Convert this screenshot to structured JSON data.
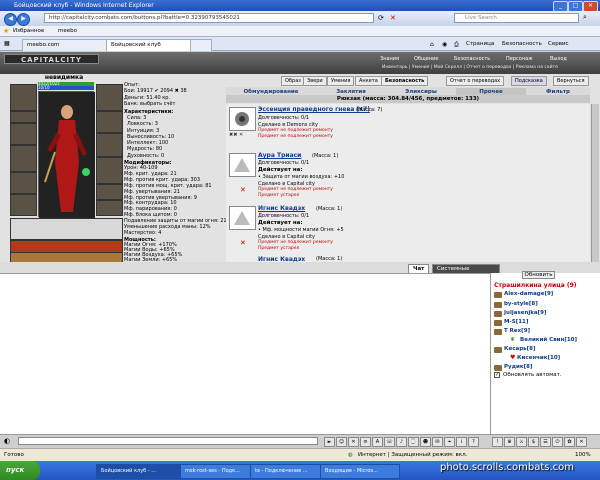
{
  "window": {
    "title": "Бойцовский клуб - Windows Internet Explorer"
  },
  "address": {
    "url": "http://capitalcity.combats.com/buttons.pl?battle=0.32390793545021",
    "search_placeholder": "Live Search"
  },
  "favorites": {
    "label": "Избранное",
    "link": "meebo"
  },
  "tabs": [
    {
      "label": "meebo.com"
    },
    {
      "label": "Бойцовский клуб"
    }
  ],
  "commands": {
    "page": "Страница",
    "security": "Безопасность",
    "service": "Сервис"
  },
  "game": {
    "logo": "CAPITALCITY",
    "nav": [
      "Знания",
      "Общение",
      "Безопасность",
      "Персонаж",
      "Выход"
    ],
    "subnav": "Инвентарь | Умения | Мой Скролл | Отчет о переводах | Реклама на сайте",
    "character": {
      "name": "невидимка",
      "hp": "1022/1022",
      "mana": "10/10",
      "stats_top": [
        "Опыт:",
        "Бои: 19917 ✔ 2094 ✖ 38",
        "Деньги: 51.40 кр.",
        "Банк: выбрать счёт"
      ],
      "characteristics_title": "Характеристики:",
      "characteristics": [
        "Сила: 3",
        "Ловкость: 3",
        "Интуиция: 3",
        "Выносливость: 10",
        "Интеллект: 100",
        "Мудрость: 80",
        "Духовность: 0"
      ],
      "modifiers_title": "Модификаторы:",
      "modifiers": [
        "Урон: 40-109",
        "Мф. крит. удара: 21",
        "Мф. против крит. удара: 303",
        "Мф. против мощ. крит. удара: 81",
        "Мф. увертывания: 21",
        "Мф. против увертывания: 9",
        "Мф. контрудара: 10",
        "Мф. парирования: 0",
        "Мф. блока щитом: 0",
        "Подавление защиты от магии огня: 21",
        "Уменьшение расхода маны: 12%",
        "Мастерство: 4"
      ],
      "powers_title": "Мощность:",
      "powers": [
        "Магии Огня: +170%",
        "Магии Воды: +65%",
        "Магии Воздуха: +65%",
        "Магии Земли: +65%"
      ]
    },
    "top_buttons": [
      "Образ",
      "Звери",
      "Умения",
      "Анкета",
      "Безопасность",
      "Отчет о переводах",
      "Подсказка",
      "Вернуться"
    ],
    "sub_tabs": [
      "Обмундирование",
      "Заклятия",
      "Эликсиры",
      "Прочее",
      "Фильтр"
    ],
    "backpack": "Рюкзак (масса: 304.84/456, предметов: 133)",
    "items": [
      {
        "name": "Эссенция праведного гнева (x7)",
        "mass": "(Масса: 7)",
        "durability": "Долговечность: 0/1",
        "made": "Сделано в Demons city",
        "warn1": "Предмет не подлежит ремонту",
        "warn2": "Предмет не подлежит ремонту"
      },
      {
        "name": "Аура Триаси",
        "mass": "(Масса: 1)",
        "durability": "Долговечность: 0/1",
        "acts": "Действует на:",
        "effect": "• Защита от магии воздуха: +10",
        "made": "Сделано в Capital city",
        "warn1": "Предмет не подлежит ремонту",
        "warn2": "Предмет устарел"
      },
      {
        "name": "Игнис Квадэх",
        "mass": "(Масса: 1)",
        "durability": "Долговечность: 0/1",
        "acts": "Действует на:",
        "effect": "• Мф. мощности магии Огня: +5",
        "made": "Сделано в Capital city",
        "warn1": "Предмет не подлежит ремонту",
        "warn2": "Предмет устарел"
      },
      {
        "name": "Игнис Квадэх",
        "mass": "(Масса: 1)"
      }
    ]
  },
  "chat": {
    "tabs": [
      "Чат",
      "Системные сообщения"
    ],
    "refresh": "Обновить",
    "location": "Страшилкина улица (9)",
    "users": [
      "Alex-damage[9]",
      "by-style[8]",
      "Juljasenjka[9]",
      "M-S[11]",
      "T Rex[9]",
      "Великий Свин[10]",
      "Кесарь[8]",
      "Кисенчик[10]",
      "Рудик[8]"
    ],
    "auto_refresh": "Обновлять автомат."
  },
  "status": {
    "left": "Готово",
    "zone": "Интернет | Защищенный режим: вкл.",
    "zoom": "100%"
  },
  "taskbar": {
    "start": "пуск",
    "tasks": [
      "Бойцовский клуб - ...",
      "msk-rost-ses - Подк...",
      "te - Подключение ...",
      "Входящие - Micros..."
    ]
  },
  "watermark": "photo.scrolls.combats.com"
}
